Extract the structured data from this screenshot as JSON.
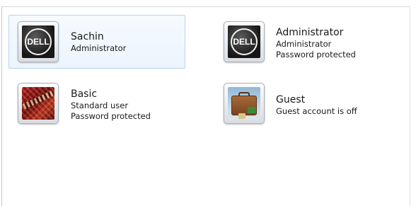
{
  "accounts": [
    {
      "name": "Sachin",
      "lines": [
        "Administrator"
      ],
      "picture": "dell-logo",
      "picture_text": "DELL"
    },
    {
      "name": "Administrator",
      "lines": [
        "Administrator",
        "Password protected"
      ],
      "picture": "dell-logo",
      "picture_text": "DELL"
    },
    {
      "name": "Basic",
      "lines": [
        "Standard user",
        "Password protected"
      ],
      "picture": "red-rug",
      "picture_text": ""
    },
    {
      "name": "Guest",
      "lines": [
        "Guest account is off"
      ],
      "picture": "suitcase",
      "picture_text": ""
    }
  ],
  "colors": {
    "selection_bg": "#ecf4fd",
    "selection_border": "#b8d4ef"
  }
}
